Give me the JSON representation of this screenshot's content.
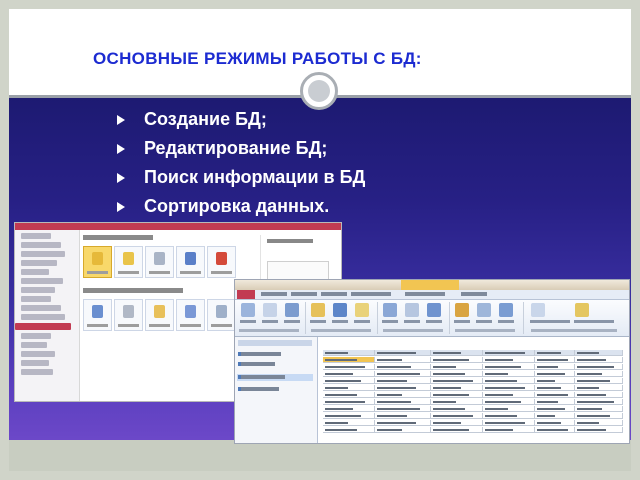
{
  "slide": {
    "title": "ОСНОВНЫЕ РЕЖИМЫ РАБОТЫ С БД:",
    "bullets": [
      {
        "text": "Создание БД;"
      },
      {
        "text": "Редактирование БД;"
      },
      {
        "text": "Поиск информации в БД"
      },
      {
        "text": "Сортировка данных."
      }
    ]
  },
  "colors": {
    "title": "#1c2bd1",
    "body_top": "#1d1a72",
    "body_bottom": "#6c48c8",
    "accent_access": "#c23b52",
    "highlight": "#f2c552"
  },
  "screenshots": [
    {
      "name": "access-backstage-new-database",
      "icon": "access-backstage-icon"
    },
    {
      "name": "access-table-datasheet-view",
      "icon": "access-datasheet-icon"
    }
  ]
}
